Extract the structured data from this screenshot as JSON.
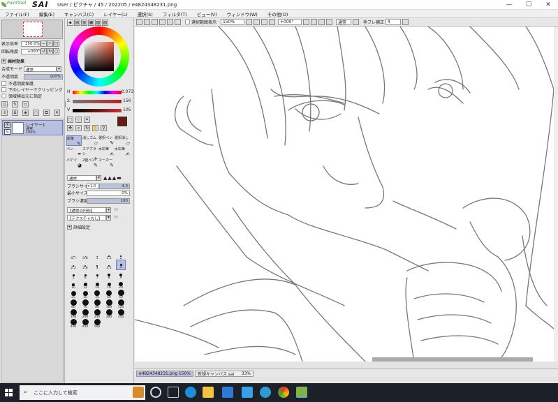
{
  "window": {
    "app_logo_small": "PaintTool",
    "app_logo": "SAI",
    "title": "User / ピクチャ / 45 / 202205 / e4824348231.png",
    "minimize": "—",
    "maximize": "☐",
    "close": "✕"
  },
  "menu": [
    "ファイル(F)",
    "編集(E)",
    "キャンバス(C)",
    "レイヤー(L)",
    "選択(S)",
    "フィルタ(T)",
    "ビュー(V)",
    "ウィンドウ(W)",
    "その他(O)"
  ],
  "navigator": {
    "zoom_label": "表示倍率",
    "zoom_value": "150.0%",
    "rotate_label": "回転角度",
    "rotate_value": "+000°"
  },
  "layer_props": {
    "header": "画材効果",
    "blend_label": "合成モード",
    "blend_value": "通常",
    "opacity_label": "不透明度",
    "opacity_value": "100%",
    "check1": "不透明度保護",
    "check2": "下のレイヤーでクリッピング",
    "check3": "領域検出元に指定"
  },
  "layers": [
    {
      "name": "レイヤー1",
      "mode": "通常",
      "opacity": "100%"
    }
  ],
  "color": {
    "h_label": "H",
    "h_value": "0.073",
    "s_label": "S",
    "s_value": "156",
    "v_label": "V",
    "v_value": "105",
    "fg_color": "#6b1a12",
    "bg_color": "#ffffff"
  },
  "tools": [
    "鉛筆",
    "消しゴム",
    "選択ペン",
    "選択消し",
    "ペン",
    "エアブラシ",
    "水彩筆",
    "水彩筆",
    "バケツ",
    "2値ペン",
    "マーカー",
    ""
  ],
  "brush": {
    "mode": "通常",
    "size_label": "ブラシサイズ",
    "size_mult": "×1.0",
    "size_value": "4.0",
    "min_label": "最小サイズ",
    "min_value": "0%",
    "density_label": "ブラシ濃度",
    "density_value": "100",
    "shape1": "【通常の円形】",
    "shape1_val": "50",
    "tex1": "【テクスチャなし】",
    "tex1_val": "95",
    "detail": "詳細設定"
  },
  "brush_sizes": [
    "0.7",
    "0.8",
    "1",
    "1.5",
    "2",
    "2.3",
    "2.6",
    "3",
    "3.5",
    "4",
    "5",
    "6",
    "7",
    "8",
    "9",
    "10",
    "12",
    "14",
    "16",
    "20",
    "25",
    "30",
    "35",
    "40",
    "50",
    "60",
    "70",
    "80",
    "100",
    "120",
    "160",
    "200",
    "250",
    "300",
    "350",
    "400",
    "450",
    "500"
  ],
  "canvas_toolbar": {
    "stabilizer_check": "選択範囲表示",
    "zoom": "150%",
    "angle": "+000°",
    "mode": "通常",
    "stab_label": "手ブレ補正",
    "stab_value": "4"
  },
  "tabs": [
    {
      "name": "e4824348231.png",
      "zoom": "150%"
    },
    {
      "name": "新規キャンバス.sai",
      "zoom": "33%"
    }
  ],
  "taskbar": {
    "search_placeholder": "ここに入力して検索"
  }
}
